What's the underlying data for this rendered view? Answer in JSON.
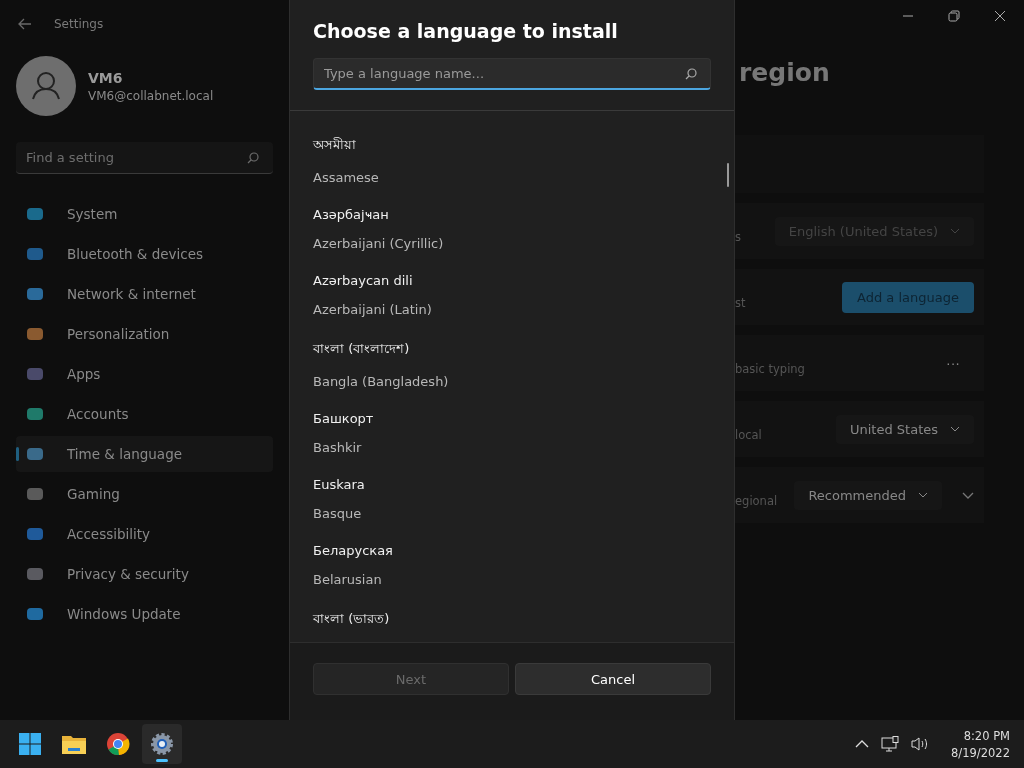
{
  "window": {
    "title": "Settings"
  },
  "user": {
    "name": "VM6",
    "email": "VM6@collabnet.local"
  },
  "search": {
    "placeholder": "Find a setting"
  },
  "sidebar": {
    "items": [
      {
        "label": "System",
        "selected": false,
        "color": "#1a6a8c"
      },
      {
        "label": "Bluetooth & devices",
        "selected": false,
        "color": "#1f5a8c"
      },
      {
        "label": "Network & internet",
        "selected": false,
        "color": "#2a6a9a"
      },
      {
        "label": "Personalization",
        "selected": false,
        "color": "#8a5a30"
      },
      {
        "label": "Apps",
        "selected": false,
        "color": "#4a4a6a"
      },
      {
        "label": "Accounts",
        "selected": false,
        "color": "#1f7a6a"
      },
      {
        "label": "Time & language",
        "selected": true,
        "color": "#3a6a8a"
      },
      {
        "label": "Gaming",
        "selected": false,
        "color": "#5a5a5a"
      },
      {
        "label": "Accessibility",
        "selected": false,
        "color": "#1f5a9a"
      },
      {
        "label": "Privacy & security",
        "selected": false,
        "color": "#5a5a60"
      },
      {
        "label": "Windows Update",
        "selected": false,
        "color": "#1f6aa0"
      }
    ]
  },
  "page": {
    "title": "region",
    "rows": [
      {
        "kind": "dropdown",
        "label": "s",
        "value": "English (United States)",
        "disabled": true
      },
      {
        "kind": "button",
        "label": "st",
        "value": "Add a language"
      },
      {
        "kind": "more",
        "label": "basic typing",
        "value": "···"
      },
      {
        "kind": "dropdown",
        "label": "local",
        "value": "United States",
        "disabled": false
      },
      {
        "kind": "dropdown-expand",
        "label": "egional",
        "value": "Recommended",
        "disabled": false
      }
    ]
  },
  "dialog": {
    "title": "Choose a language to install",
    "search": {
      "placeholder": "Type a language name..."
    },
    "languages": [
      {
        "native": "অসমীয়া",
        "english": "Assamese"
      },
      {
        "native": "Азәрбајҹан",
        "english": "Azerbaijani (Cyrillic)"
      },
      {
        "native": "Azərbaycan dili",
        "english": "Azerbaijani (Latin)"
      },
      {
        "native": "বাংলা (বাংলাদেশ)",
        "english": "Bangla (Bangladesh)"
      },
      {
        "native": "Башкорт",
        "english": "Bashkir"
      },
      {
        "native": "Euskara",
        "english": "Basque"
      },
      {
        "native": "Беларуская",
        "english": "Belarusian"
      },
      {
        "native": "বাংলা (ভারত)"
      }
    ],
    "buttons": [
      {
        "label": "Next",
        "disabled": true
      },
      {
        "label": "Cancel",
        "disabled": false
      }
    ]
  },
  "taskbar": {
    "apps": [
      {
        "kind": "start",
        "selected": false
      },
      {
        "kind": "folder",
        "selected": false
      },
      {
        "kind": "browser",
        "selected": false
      },
      {
        "kind": "settings",
        "selected": true
      }
    ],
    "time": "8:20 PM",
    "date": "8/19/2022"
  }
}
